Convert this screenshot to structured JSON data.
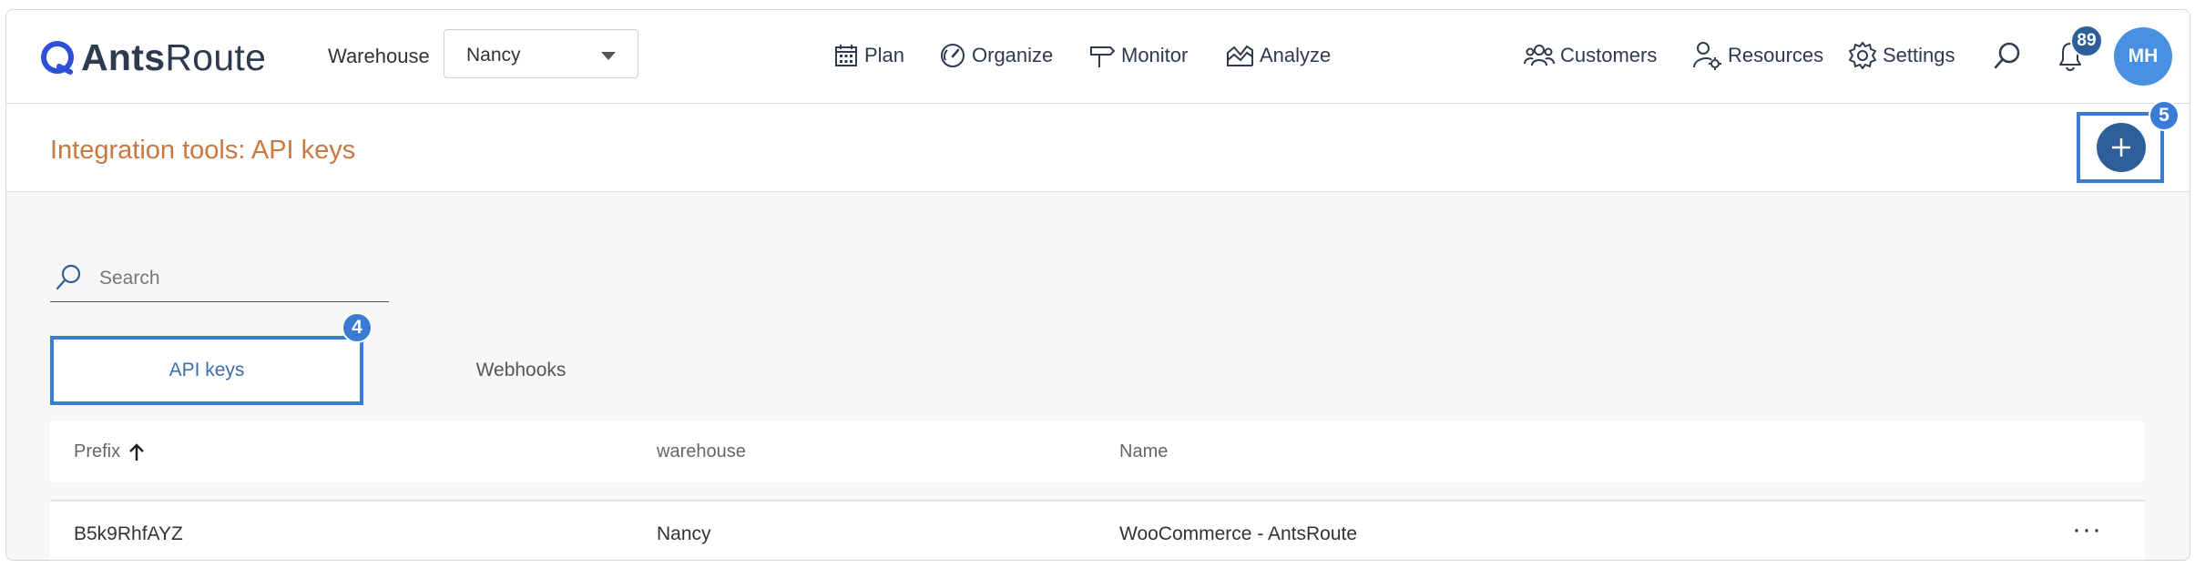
{
  "app": {
    "logo_bold": "Ants",
    "logo_light": "Route"
  },
  "topbar": {
    "warehouse_label": "Warehouse",
    "warehouse_value": "Nancy",
    "nav": [
      {
        "label": "Plan",
        "icon": "calendar-icon"
      },
      {
        "label": "Organize",
        "icon": "gauge-icon"
      },
      {
        "label": "Monitor",
        "icon": "signpost-icon"
      },
      {
        "label": "Analyze",
        "icon": "chart-icon"
      }
    ],
    "right_nav": [
      {
        "label": "Customers",
        "icon": "customers-icon"
      },
      {
        "label": "Resources",
        "icon": "resources-icon"
      },
      {
        "label": "Settings",
        "icon": "gear-icon"
      }
    ],
    "notifications_count": "89",
    "avatar_initials": "MH"
  },
  "page": {
    "title": "Integration tools: API keys",
    "add_marker": "5"
  },
  "search": {
    "placeholder": "Search",
    "value": ""
  },
  "tabs": [
    {
      "label": "API keys",
      "active": true,
      "marker": "4"
    },
    {
      "label": "Webhooks",
      "active": false
    }
  ],
  "table": {
    "columns": [
      "Prefix",
      "warehouse",
      "Name"
    ],
    "sort": {
      "column": "Prefix",
      "direction": "asc"
    },
    "rows": [
      {
        "prefix": "B5k9RhfAYZ",
        "warehouse": "Nancy",
        "name": "WooCommerce - AntsRoute",
        "actions": "···"
      }
    ]
  },
  "colors": {
    "accent": "#2f5f9a",
    "title": "#c9783f",
    "highlight": "#3a7bd5",
    "avatar": "#4a90e2"
  }
}
